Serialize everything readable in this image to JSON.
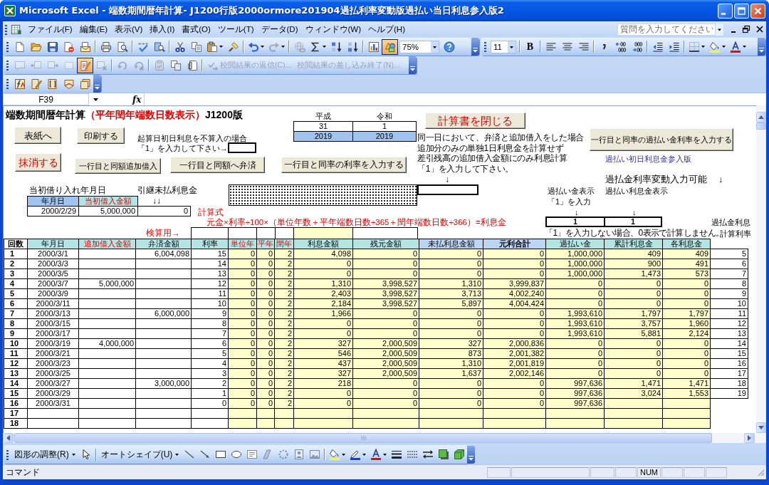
{
  "window": {
    "title": "Microsoft Excel - 端数期間暦年計算- J1200行版2000ormore201904過払利率変動版過払い当日利息参入版2"
  },
  "menu": {
    "items": [
      "ファイル(F)",
      "編集(E)",
      "表示(V)",
      "挿入(I)",
      "書式(O)",
      "ツール(T)",
      "データ(D)",
      "ウィンドウ(W)",
      "ヘルプ(H)"
    ],
    "help_search": {
      "placeholder": "質問を入力してください"
    }
  },
  "standard_toolbar": {
    "buttons": [
      {
        "disabled": false,
        "pressed": false
      },
      {
        "disabled": false,
        "pressed": false
      },
      {
        "disabled": false,
        "pressed": false
      },
      {
        "disabled": false,
        "pressed": false
      },
      {
        "disabled": false,
        "pressed": false
      },
      {
        "disabled": false,
        "pressed": false
      },
      {
        "disabled": false,
        "pressed": false
      },
      {
        "disabled": false,
        "pressed": false
      },
      {
        "disabled": false,
        "pressed": false
      },
      {
        "disabled": false,
        "pressed": false
      },
      {
        "disabled": false,
        "pressed": false
      },
      {
        "disabled": false,
        "pressed": false
      },
      {
        "disabled": false,
        "pressed": false
      },
      {
        "disabled": false,
        "pressed": false
      },
      {
        "disabled": true,
        "pressed": false
      },
      {
        "disabled": true,
        "pressed": false
      },
      {
        "disabled": false,
        "pressed": false
      },
      {
        "disabled": false,
        "pressed": false
      },
      {
        "disabled": false,
        "pressed": false
      },
      {
        "disabled": false,
        "pressed": false
      },
      {
        "disabled": false,
        "pressed": true
      },
      {
        "disabled": false,
        "pressed": false
      }
    ],
    "zoom": "75%"
  },
  "formatting_toolbar": {
    "font_size": "11",
    "bold": "B"
  },
  "reviewing_toolbar": {
    "buttons": [
      {
        "disabled": true,
        "pressed": false
      },
      {
        "disabled": true,
        "pressed": false
      },
      {
        "disabled": true,
        "pressed": false
      },
      {
        "disabled": true,
        "pressed": false
      },
      {
        "disabled": false,
        "pressed": true
      },
      {
        "disabled": true,
        "pressed": false
      },
      {
        "disabled": true,
        "pressed": false
      },
      {
        "disabled": true,
        "pressed": false
      },
      {
        "disabled": true,
        "pressed": false
      },
      {
        "disabled": false,
        "pressed": false
      },
      {
        "disabled": false,
        "pressed": false
      }
    ],
    "commands": [
      {
        "label": "校閲結果の返信(C)...",
        "disabled": true
      },
      {
        "label": "校閲結果の差し込み終了(N)...",
        "disabled": true
      }
    ]
  },
  "formula_bar": {
    "name_box": "F39",
    "function_label": "fx"
  },
  "sheet": {
    "title": "端数期間暦年計算",
    "subtitle": "（平年閏年端数日数表示）",
    "edition": "J1200版",
    "era_table": {
      "headers": [
        "平成",
        "令和"
      ],
      "rows": [
        {
          "kind": "era",
          "cells": [
            "31",
            "1"
          ]
        },
        {
          "kind": "western",
          "cells": [
            "2019",
            "2019"
          ]
        }
      ]
    },
    "buttons": [
      {
        "label": "表紙へ",
        "emphasized": false
      },
      {
        "label": "印刷する",
        "emphasized": false
      },
      {
        "label": "計算書を閉じる",
        "emphasized": true
      },
      {
        "label": "一行目と同率の過払い金利率を入力する",
        "emphasized": false
      },
      {
        "label": "抹消する",
        "emphasized": true
      },
      {
        "label": "一行目と同額追加借入",
        "emphasized": false
      },
      {
        "label": "一行目と同額へ弁済",
        "emphasized": false
      },
      {
        "label": "一行目と同率の利率を入力する",
        "emphasized": false
      }
    ],
    "exclude_first_day": {
      "label": "起算日初日利息を不算入の場合",
      "hint": "「1」を入力して下さい→"
    },
    "same_day_option": {
      "lines": [
        "同一日において、弁済と追加借入をした場合",
        "追加分のみの単独1日利息金を計算せず",
        "差引残高の追加借入金額にのみ利息計算",
        "「1」を入力して下さい。"
      ],
      "arrow": "↓"
    },
    "version_note": "過払い初日利息金参入版",
    "overpayment": {
      "heading": "過払金利率変動入力可能",
      "heading_arrow": "↓",
      "interest_label": "過払い利息金表示",
      "display_label": "過払い金表示",
      "display_hint": "「1」を入力",
      "display_arrow": "↓",
      "interest_arrow": "↓",
      "display_value": "1",
      "interest_value": "1",
      "footnote": "「1」を入力しない場合、0表示で計算しません。"
    },
    "initial_loan": {
      "caption": "当初借り入れ年月日",
      "headers": [
        {
          "label": "年月日",
          "emphasized": false
        },
        {
          "label": "当初借入金額",
          "emphasized": true
        }
      ],
      "values": [
        "2000/2/29",
        "5,000,000",
        "0"
      ]
    },
    "carryover": {
      "label": "引継未払利息金",
      "arrow": "↓↓"
    },
    "formula": {
      "label": "計算式",
      "text": "元金×利率÷100×（単位年数＋平年端数日数÷365＋閏年端数日数÷366）=利息金"
    },
    "check_label": "検算用→",
    "rate_column_note": [
      "過払金利息",
      "計算利率"
    ],
    "table": {
      "columns": [
        {
          "label": "回数",
          "kind": "index",
          "emphasized": false
        },
        {
          "label": "年月日",
          "kind": "date",
          "emphasized": false
        },
        {
          "label": "追加借入金額",
          "kind": "input",
          "emphasized": true
        },
        {
          "label": "弁済金額",
          "kind": "input",
          "emphasized": false
        },
        {
          "label": "利率",
          "kind": "input",
          "emphasized": false
        },
        {
          "label": "単位年",
          "kind": "computed",
          "emphasized": true
        },
        {
          "label": "平年",
          "kind": "computed",
          "emphasized": true
        },
        {
          "label": "閏年",
          "kind": "computed",
          "emphasized": true
        },
        {
          "label": "利息金額",
          "kind": "computed",
          "emphasized": false
        },
        {
          "label": "残元金額",
          "kind": "computed",
          "emphasized": false
        },
        {
          "label": "未払利息金額",
          "kind": "balance",
          "emphasized": false
        },
        {
          "label": "元利合計",
          "kind": "total",
          "emphasized": false
        },
        {
          "label": "過払い金",
          "kind": "computed",
          "emphasized": false
        },
        {
          "label": "累計利息金",
          "kind": "computed",
          "emphasized": false
        },
        {
          "label": "各利息金",
          "kind": "computed",
          "emphasized": false
        },
        {
          "kind": "extra"
        }
      ],
      "rows": [
        [
          "1",
          "2000/3/1",
          null,
          "6,004,098",
          "15",
          "0",
          "0",
          "2",
          "4,098",
          "0",
          "0",
          "0",
          "1,000,000",
          "409",
          "409",
          "5"
        ],
        [
          "2",
          "2000/3/3",
          null,
          null,
          "14",
          "0",
          "0",
          "2",
          "0",
          "0",
          "0",
          "0",
          "1,000,000",
          "900",
          "491",
          "6"
        ],
        [
          "3",
          "2000/3/5",
          null,
          null,
          "13",
          "0",
          "0",
          "2",
          "0",
          "0",
          "0",
          "0",
          "1,000,000",
          "1,473",
          "573",
          "7"
        ],
        [
          "4",
          "2000/3/7",
          "5,000,000",
          null,
          "12",
          "0",
          "0",
          "2",
          "1,310",
          "3,998,527",
          "1,310",
          "3,999,837",
          "0",
          "0",
          "0",
          "8"
        ],
        [
          "5",
          "2000/3/9",
          null,
          null,
          "11",
          "0",
          "0",
          "2",
          "2,403",
          "3,998,527",
          "3,713",
          "4,002,240",
          "0",
          "0",
          "0",
          "9"
        ],
        [
          "6",
          "2000/3/11",
          null,
          null,
          "10",
          "0",
          "0",
          "2",
          "2,184",
          "3,998,527",
          "5,897",
          "4,004,424",
          "0",
          "0",
          "0",
          "10"
        ],
        [
          "7",
          "2000/3/13",
          null,
          "6,000,000",
          "9",
          "0",
          "0",
          "2",
          "1,966",
          "0",
          "0",
          "0",
          "1,993,610",
          "1,797",
          "1,797",
          "11"
        ],
        [
          "8",
          "2000/3/15",
          null,
          null,
          "8",
          "0",
          "0",
          "2",
          "0",
          "0",
          "0",
          "0",
          "1,993,610",
          "3,757",
          "1,960",
          "12"
        ],
        [
          "9",
          "2000/3/17",
          null,
          null,
          "7",
          "0",
          "0",
          "2",
          "0",
          "0",
          "0",
          "0",
          "1,993,610",
          "5,881",
          "2,124",
          "13"
        ],
        [
          "10",
          "2000/3/19",
          "4,000,000",
          null,
          "6",
          "0",
          "0",
          "2",
          "327",
          "2,000,509",
          "327",
          "2,000,836",
          "0",
          "0",
          "0",
          "14"
        ],
        [
          "11",
          "2000/3/21",
          null,
          null,
          "5",
          "0",
          "0",
          "2",
          "546",
          "2,000,509",
          "873",
          "2,001,382",
          "0",
          "0",
          "0",
          "15"
        ],
        [
          "12",
          "2000/3/23",
          null,
          null,
          "4",
          "0",
          "0",
          "2",
          "437",
          "2,000,509",
          "1,310",
          "2,001,819",
          "0",
          "0",
          "0",
          "16"
        ],
        [
          "13",
          "2000/3/25",
          null,
          null,
          "3",
          "0",
          "0",
          "2",
          "327",
          "2,000,509",
          "1,637",
          "2,002,146",
          "0",
          "0",
          "0",
          "17"
        ],
        [
          "14",
          "2000/3/27",
          null,
          "3,000,000",
          "2",
          "0",
          "0",
          "2",
          "218",
          "0",
          "0",
          "0",
          "997,636",
          "1,471",
          "1,471",
          "18"
        ],
        [
          "15",
          "2000/3/29",
          null,
          null,
          "1",
          "0",
          "0",
          "2",
          "0",
          "0",
          "0",
          "0",
          "997,636",
          "3,024",
          "1,553",
          "19"
        ],
        [
          "16",
          "2000/3/31",
          null,
          null,
          "0",
          "0",
          "0",
          "2",
          "0",
          "0",
          "0",
          "0",
          "997,636",
          null,
          null,
          null
        ],
        [
          "17",
          null,
          null,
          null,
          null,
          null,
          null,
          null,
          null,
          null,
          null,
          null,
          null,
          null,
          null,
          null
        ],
        [
          "18",
          null,
          null,
          null,
          null,
          null,
          null,
          null,
          null,
          null,
          null,
          null,
          null,
          null,
          null,
          null
        ]
      ]
    }
  },
  "drawing_toolbar": {
    "draw_menu": "図形の調整(R)",
    "autoshapes_menu": "オートシェイプ(U)"
  },
  "status_bar": {
    "message": "コマンド",
    "num_lock": "NUM"
  }
}
